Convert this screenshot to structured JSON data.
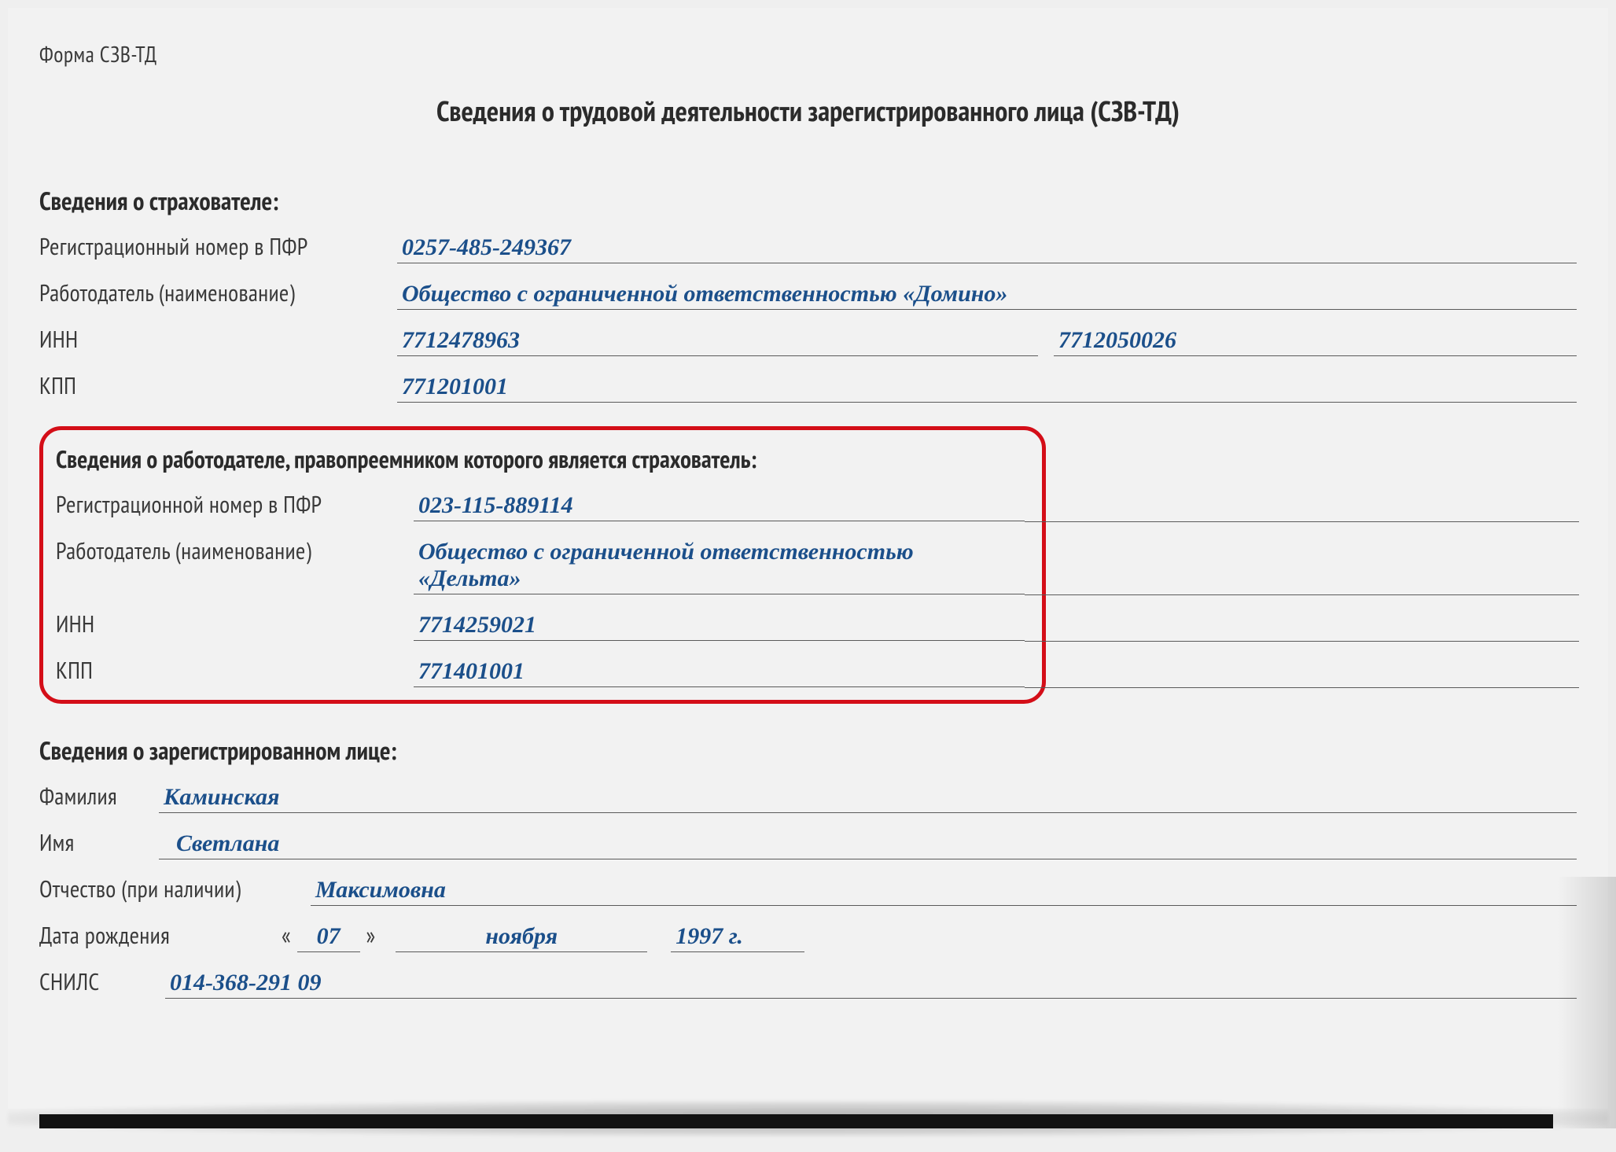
{
  "form_code": "Форма СЗВ-ТД",
  "title": "Сведения о трудовой деятельности зарегистрированного лица (СЗВ-ТД)",
  "insurer": {
    "heading": "Сведения о страхователе:",
    "labels": {
      "reg_no": "Регистрационный номер в ПФР",
      "employer": "Работодатель (наименование)",
      "inn": "ИНН",
      "kpp": "КПП"
    },
    "reg_no": "0257-485-249367",
    "employer": "Общество с ограниченной ответственностью «Домино»",
    "inn": "7712478963",
    "inn_second": "7712050026",
    "kpp": "771201001"
  },
  "predecessor": {
    "heading": "Сведения о работодателе, правопреемником которого является страхователь:",
    "labels": {
      "reg_no": "Регистрационной номер в ПФР",
      "employer": "Работодатель (наименование)",
      "inn": "ИНН",
      "kpp": "КПП"
    },
    "reg_no": "023-115-889114",
    "employer": "Общество с ограниченной ответственностью «Дельта»",
    "inn": "7714259021",
    "kpp": "771401001"
  },
  "person": {
    "heading": "Сведения о зарегистрированном лице:",
    "labels": {
      "surname": "Фамилия",
      "name": "Имя",
      "patronymic": "Отчество (при наличии)",
      "dob": "Дата рождения",
      "snils": "СНИЛС"
    },
    "surname": "Каминская",
    "name": "Светлана",
    "patronymic": "Максимовна",
    "dob_day": "07",
    "dob_month": "ноября",
    "dob_year": "1997 г.",
    "snils": "014-368-291 09"
  }
}
